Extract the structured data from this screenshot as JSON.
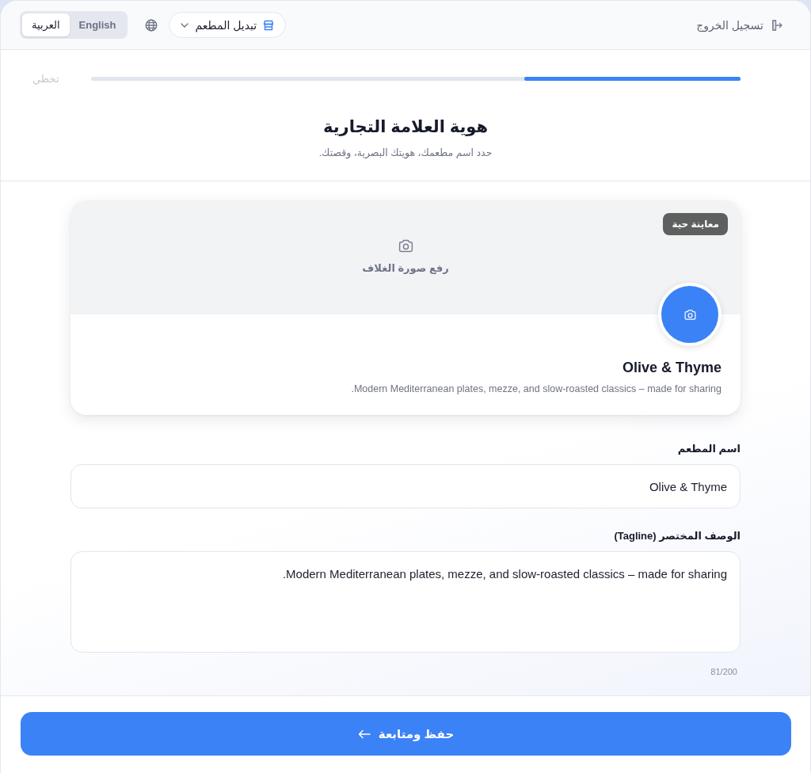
{
  "header": {
    "logout": {
      "label": "تسجيل الخروج"
    },
    "restaurant_switcher": {
      "label": "تبديل المطعم"
    },
    "language_toggle": [
      {
        "label": "English",
        "selected": false
      },
      {
        "label": "العربية",
        "selected": true
      }
    ]
  },
  "progress": {
    "level": 0.333,
    "skip": "تخطي"
  },
  "heading": {
    "title": "هوية العلامة التجارية",
    "subtitle": "حدد اسم مطعمك، هويتك البصرية، وقصتك."
  },
  "preview": {
    "badge": "معاينة حية",
    "cover_label": "رفع صورة الغلاف",
    "name": "Olive & Thyme",
    "tagline": "Modern Mediterranean plates, mezze, and slow-roasted classics – made for sharing."
  },
  "fields": [
    {
      "kind": "input",
      "label": "اسم المطعم",
      "value": "Olive & Thyme"
    },
    {
      "kind": "textarea",
      "label": "الوصف المختصر (Tagline)",
      "value": "Modern Mediterranean plates, mezze, and slow-roasted classics – made for sharing.",
      "counter": "81/200"
    }
  ],
  "footer": {
    "button": "حفظ ومتابعة"
  }
}
